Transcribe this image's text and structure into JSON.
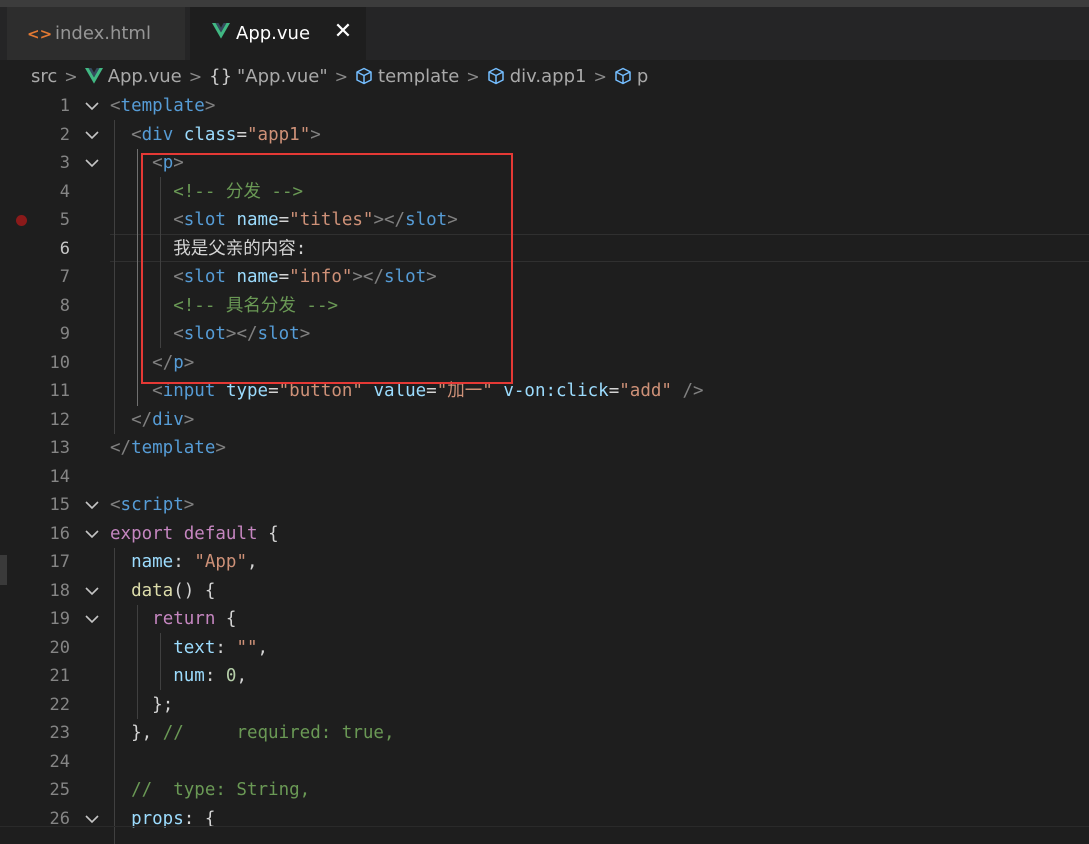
{
  "tabs": [
    {
      "label": "index.html",
      "icon": "html-file-icon",
      "active": false
    },
    {
      "label": "App.vue",
      "icon": "vue-file-icon",
      "active": true
    }
  ],
  "tab_close_glyph": "✕",
  "breadcrumb": {
    "items": [
      "src",
      "App.vue",
      "\"App.vue\"",
      "template",
      "div.app1",
      "p"
    ],
    "braces": "{}"
  },
  "editor": {
    "line_numbers": [
      "1",
      "2",
      "3",
      "4",
      "5",
      "6",
      "7",
      "8",
      "9",
      "10",
      "11",
      "12",
      "13",
      "14",
      "15",
      "16",
      "17",
      "18",
      "19",
      "20",
      "21",
      "22",
      "23",
      "24",
      "25",
      "26"
    ],
    "current_line": "6",
    "breakpoint_line": "5"
  },
  "colors": {
    "background": "#1e1e1e",
    "tab_bar": "#252526",
    "highlight_box": "#e53935",
    "vue_green": "#41b883",
    "html_orange": "#e37933"
  }
}
